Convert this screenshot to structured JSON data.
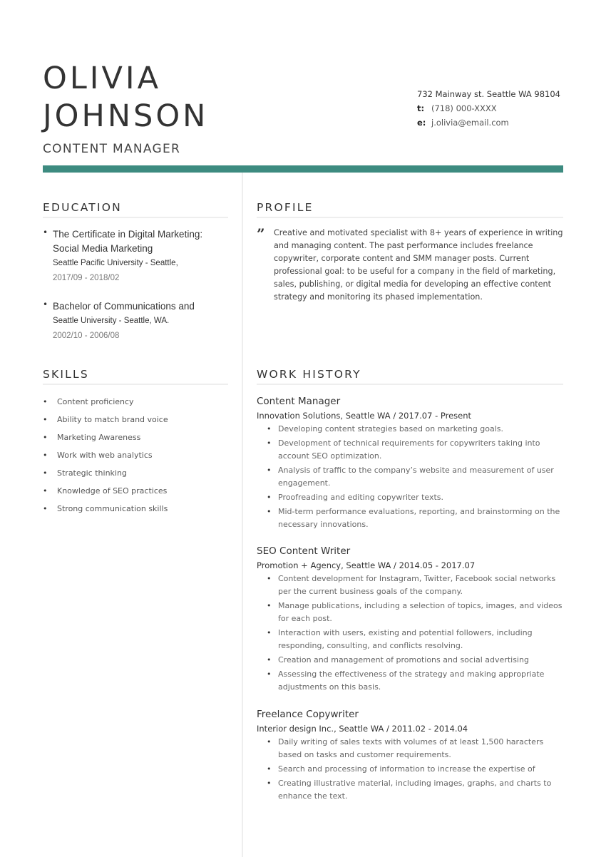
{
  "header": {
    "first_name": "OLIVIA",
    "last_name": "JOHNSON",
    "job_title": "CONTENT MANAGER",
    "accent_color": "#3d8b80"
  },
  "contact": {
    "address": "732 Mainway st. Seattle WA 98104",
    "phone_label": "t:",
    "phone": "(718) 000-XXXX",
    "email_label": "e:",
    "email": "j.olivia@email.com"
  },
  "education": {
    "heading": "EDUCATION",
    "items": [
      {
        "degree": "The Certificate in Digital Marketing: Social Media Marketing",
        "school": "Seattle Pacific University - Seattle,",
        "dates": "2017/09 - 2018/02"
      },
      {
        "degree": "Bachelor of Communications and",
        "school": "Seattle University - Seattle, WA.",
        "dates": "2002/10 - 2006/08"
      }
    ]
  },
  "skills": {
    "heading": "SKILLS",
    "items": [
      "Content proficiency",
      "Ability to match brand voice",
      "Marketing Awareness",
      "Work with web analytics",
      "Strategic thinking",
      "Knowledge of SEO practices",
      "Strong communication skills"
    ]
  },
  "profile": {
    "heading": "PROFILE",
    "icon": "quote-icon",
    "text": "Creative and motivated specialist with 8+ years of experience in writing and managing content. The past performance includes freelance copywriter, corporate content and SMM manager posts. Current professional goal: to be useful for a company in the field of marketing, sales, publishing, or digital media for developing an effective content strategy and monitoring its phased implementation."
  },
  "work_history": {
    "heading": "WORK HISTORY",
    "jobs": [
      {
        "title": "Content Manager",
        "meta": "Innovation Solutions, Seattle WA / 2017.07 - Present",
        "bullets": [
          "Developing content strategies based on marketing goals.",
          "Development of technical requirements for copywriters taking into account SEO optimization.",
          "Analysis of traffic to the company’s website and measurement of user engagement.",
          "Proofreading and editing copywriter texts.",
          "Mid-term performance evaluations, reporting, and brainstorming on the necessary innovations."
        ]
      },
      {
        "title": "SEO Content Writer",
        "meta": "Promotion + Agency, Seattle WA / 2014.05 - 2017.07",
        "bullets": [
          "Content development for Instagram, Twitter, Facebook social networks per the current business goals of the company.",
          "Manage publications, including a selection of topics, images, and videos for each post.",
          "Interaction with users, existing and potential followers, including responding, consulting, and conflicts resolving.",
          "Creation and management of promotions and social advertising",
          "Assessing the effectiveness of the strategy and making appropriate adjustments on this basis."
        ]
      },
      {
        "title": "Freelance Copywriter",
        "meta": "Interior design Inc., Seattle WA / 2011.02 - 2014.04",
        "bullets": [
          "Daily writing of sales texts with volumes of at least 1,500 haracters based on tasks and customer requirements.",
          "Search and processing of information to increase the expertise of",
          "Creating illustrative material, including images, graphs, and charts to enhance the text."
        ]
      }
    ]
  }
}
